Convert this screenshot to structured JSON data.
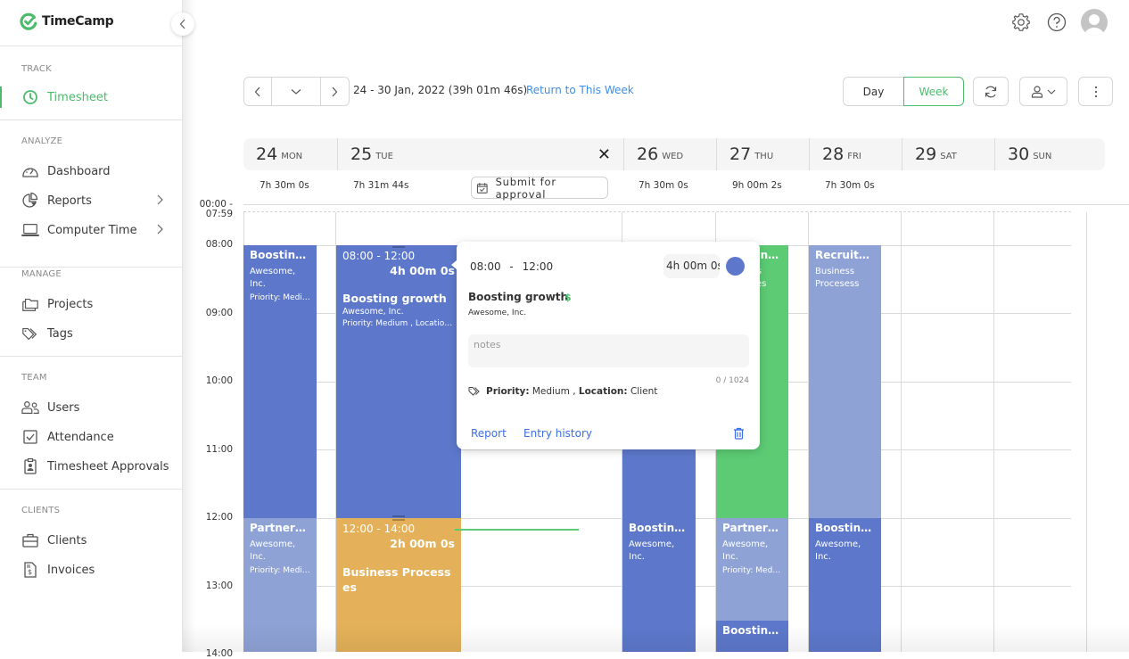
{
  "app": {
    "name": "TimeCamp",
    "brand_color": "#4cbb6c"
  },
  "sidebar": {
    "sections": [
      {
        "label": "TRACK",
        "items": [
          {
            "label": "Timesheet",
            "icon": "clock-icon",
            "active": true
          }
        ]
      },
      {
        "label": "ANALYZE",
        "items": [
          {
            "label": "Dashboard",
            "icon": "gauge-icon"
          },
          {
            "label": "Reports",
            "icon": "pie-chart-icon",
            "has_submenu": true
          },
          {
            "label": "Computer Time",
            "icon": "laptop-icon",
            "has_submenu": true
          }
        ]
      },
      {
        "label": "MANAGE",
        "items": [
          {
            "label": "Projects",
            "icon": "folder-icon"
          },
          {
            "label": "Tags",
            "icon": "tag-icon"
          }
        ]
      },
      {
        "label": "TEAM",
        "items": [
          {
            "label": "Users",
            "icon": "users-icon"
          },
          {
            "label": "Attendance",
            "icon": "checkbox-icon"
          },
          {
            "label": "Timesheet Approvals",
            "icon": "clipboard-user-icon"
          }
        ]
      },
      {
        "label": "CLIENTS",
        "items": [
          {
            "label": "Clients",
            "icon": "briefcase-icon"
          },
          {
            "label": "Invoices",
            "icon": "invoice-icon"
          }
        ]
      }
    ]
  },
  "toolbar": {
    "range": "24 - 30 Jan, 2022 (39h 01m 46s)",
    "return_link": "Return to This Week",
    "view_day": "Day",
    "view_week": "Week",
    "active_view": "Week"
  },
  "days": [
    {
      "num": "24",
      "name": "MON",
      "total": "7h 30m 0s"
    },
    {
      "num": "25",
      "name": "TUE",
      "total": "7h 31m 44s",
      "expanded": true
    },
    {
      "num": "26",
      "name": "WED",
      "total": "7h 30m 0s"
    },
    {
      "num": "27",
      "name": "THU",
      "total": "9h 00m 2s"
    },
    {
      "num": "28",
      "name": "FRI",
      "total": "7h 30m 0s"
    },
    {
      "num": "29",
      "name": "SAT",
      "total": ""
    },
    {
      "num": "30",
      "name": "SUN",
      "total": ""
    }
  ],
  "submit_label": "Submit for approval",
  "time_labels": {
    "early": "00:00 - 07:59",
    "h08": "08:00",
    "h09": "09:00",
    "h10": "10:00",
    "h11": "11:00",
    "h12": "12:00",
    "h13": "13:00",
    "h14": "14:00"
  },
  "events": {
    "mon1": {
      "title": "Boosting growth",
      "client": "Awesome, Inc.",
      "tags": "Priority: Medium",
      "color": "#5d78cb"
    },
    "mon2": {
      "title": "Partnerships",
      "client": "Awesome, Inc.",
      "tags": "Priority: Medium",
      "color": "#8ea2d5"
    },
    "tue1": {
      "range": "08:00 - 12:00",
      "duration": "4h 00m 0s",
      "title": "Boosting growth",
      "client": "Awesome, Inc.",
      "tags": "Priority: Medium , Location: Client",
      "color": "#5d78cb"
    },
    "tue2": {
      "range": "12:00 - 14:00",
      "duration": "2h 00m 0s",
      "title": "Business Processes",
      "color": "#e4b15a"
    },
    "wed1": {
      "title": "Boosting growth",
      "client": "Awesome, Inc.",
      "color": "#5d78cb"
    },
    "thu1": {
      "title": "Boosting growth",
      "client": "Business Processes",
      "color": "#5ccb74"
    },
    "thu2": {
      "title": "Partnerships",
      "client": "Awesome, Inc.",
      "tags": "Priority: Medium",
      "color": "#8ea2d5"
    },
    "thu3": {
      "title": "Boosting growth",
      "color": "#5d78cb"
    },
    "fri1": {
      "title": "Recruitment",
      "client": "Business Procesess",
      "color": "#8ea2d5"
    },
    "fri2": {
      "title": "Boosting growth",
      "client": "Awesome, Inc.",
      "color": "#5d78cb"
    }
  },
  "popup": {
    "start": "08:00",
    "sep": "-",
    "end": "12:00",
    "duration": "4h 00m 0s",
    "title": "Boosting growth",
    "billable_symbol": "$",
    "client": "Awesome, Inc.",
    "notes_placeholder": "notes",
    "notes_value": "",
    "char_count": "0 / 1024",
    "tag1_key": "Priority:",
    "tag1_val": "Medium ,",
    "tag2_key": "Location:",
    "tag2_val": "Client",
    "report_link": "Report",
    "history_link": "Entry history",
    "color": "#5d78cb"
  }
}
